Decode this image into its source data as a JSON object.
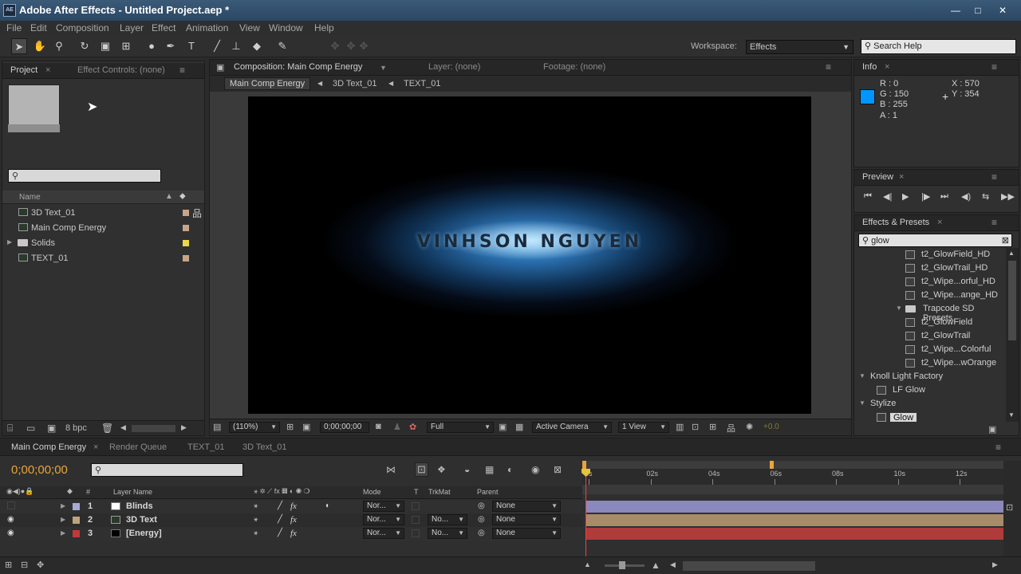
{
  "title_bar": {
    "app_icon": "AE",
    "title": "Adobe After Effects - Untitled Project.aep *",
    "min": "—",
    "max": "□",
    "close": "✕"
  },
  "menu": [
    "File",
    "Edit",
    "Composition",
    "Layer",
    "Effect",
    "Animation",
    "View",
    "Window",
    "Help"
  ],
  "toolbar": {
    "workspace_label": "Workspace:",
    "workspace_value": "Effects",
    "search_help": "Search Help"
  },
  "project_panel": {
    "tab_project": "Project",
    "tab_effect_controls": "Effect Controls: (none)",
    "col_name": "Name",
    "items": [
      {
        "name": "3D Text_01",
        "type": "comp",
        "color": "#c6a58a"
      },
      {
        "name": "Main Comp Energy",
        "type": "comp",
        "color": "#c6a58a"
      },
      {
        "name": "Solids",
        "type": "folder",
        "color": "#e8d84a"
      },
      {
        "name": "TEXT_01",
        "type": "comp",
        "color": "#c6a58a"
      }
    ],
    "bpc": "8 bpc"
  },
  "comp_panel": {
    "tab_comp": "Composition: Main Comp Energy",
    "tab_layer": "Layer: (none)",
    "tab_footage": "Footage: (none)",
    "breadcrumbs": [
      "Main Comp Energy",
      "3D Text_01",
      "TEXT_01"
    ],
    "viewer_text": "VINHSON NGUYEN",
    "zoom": "(110%)",
    "timecode": "0;00;00;00",
    "resolution": "Full",
    "camera": "Active Camera",
    "views": "1 View",
    "exposure": "+0.0"
  },
  "info_panel": {
    "tab": "Info",
    "r": "R : 0",
    "g": "G : 150",
    "b": "B : 255",
    "a": "A : 1",
    "x": "X : 570",
    "y": "Y : 354",
    "swatch_color": "#0096ff"
  },
  "preview_panel": {
    "tab": "Preview"
  },
  "effects_panel": {
    "tab": "Effects & Presets",
    "search": "glow",
    "items": [
      {
        "label": "t2_GlowField_HD",
        "indent": 3,
        "kind": "preset"
      },
      {
        "label": "t2_GlowTrail_HD",
        "indent": 3,
        "kind": "preset"
      },
      {
        "label": "t2_Wipe...orful_HD",
        "indent": 3,
        "kind": "preset"
      },
      {
        "label": "t2_Wipe...ange_HD",
        "indent": 3,
        "kind": "preset"
      },
      {
        "label": "Trapcode SD Presets",
        "indent": 2,
        "kind": "folder"
      },
      {
        "label": "t2_GlowField",
        "indent": 3,
        "kind": "preset"
      },
      {
        "label": "t2_GlowTrail",
        "indent": 3,
        "kind": "preset"
      },
      {
        "label": "t2_Wipe...Colorful",
        "indent": 3,
        "kind": "preset"
      },
      {
        "label": "t2_Wipe...wOrange",
        "indent": 3,
        "kind": "preset"
      },
      {
        "label": "Knoll Light Factory",
        "indent": 0,
        "kind": "category"
      },
      {
        "label": "LF Glow",
        "indent": 1,
        "kind": "effect"
      },
      {
        "label": "Stylize",
        "indent": 0,
        "kind": "category"
      },
      {
        "label": "Glow",
        "indent": 1,
        "kind": "effect-selected"
      }
    ]
  },
  "timeline": {
    "tabs": [
      "Main Comp Energy",
      "Render Queue",
      "TEXT_01",
      "3D Text_01"
    ],
    "timecode": "0;00;00;00",
    "col_layer_name": "Layer Name",
    "col_mode": "Mode",
    "col_t": "T",
    "col_trkmat": "TrkMat",
    "col_parent": "Parent",
    "ruler": [
      "0s",
      "02s",
      "04s",
      "06s",
      "08s",
      "10s",
      "12s"
    ],
    "layers": [
      {
        "num": "1",
        "name": "Blinds",
        "label_color": "#a9a8d8",
        "swatch": "#ffffff",
        "mode": "Nor...",
        "trkmat": "",
        "parent": "None",
        "bar_color": "#8b88be",
        "visible": false
      },
      {
        "num": "2",
        "name": "3D Text",
        "label_color": "#bfa27e",
        "swatch": "comp",
        "mode": "Nor...",
        "trkmat": "No...",
        "parent": "None",
        "bar_color": "#a88b68",
        "visible": true
      },
      {
        "num": "3",
        "name": "[Energy]",
        "label_color": "#c03a3a",
        "swatch": "#000000",
        "mode": "Nor...",
        "trkmat": "No...",
        "parent": "None",
        "bar_color": "#b03b3b",
        "visible": true
      }
    ]
  },
  "colors": {
    "accent_timecode": "#e8a53a",
    "playhead": "#ff3a3a"
  }
}
